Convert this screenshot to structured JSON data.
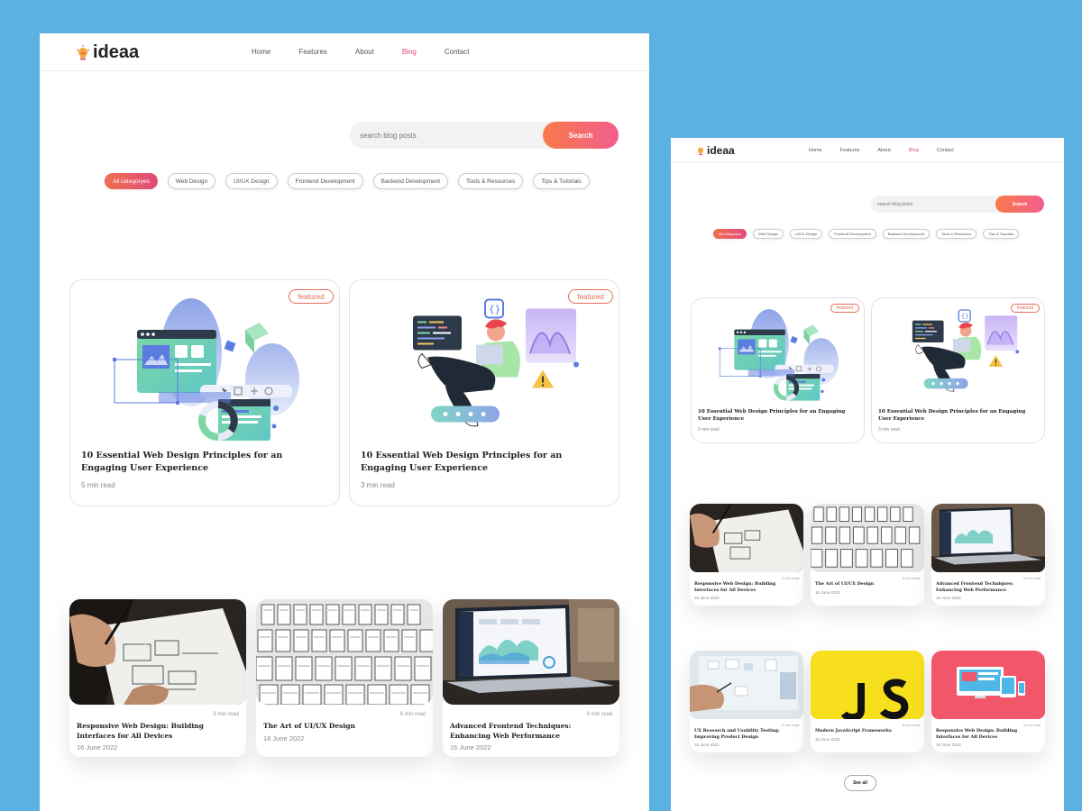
{
  "brand": {
    "name": "ideaa"
  },
  "nav": [
    "Home",
    "Features",
    "About",
    "Blog",
    "Contact"
  ],
  "nav_active": "Blog",
  "search": {
    "placeholder": "search blog posts",
    "button": "Search"
  },
  "categories": [
    "All categoryes",
    "Web Design",
    "UI/UX Design",
    "Frontend Development",
    "Backend Development",
    "Tools & Resources",
    "Tips & Tutorials"
  ],
  "featured": [
    {
      "badge": "featured",
      "title": "10 Essential Web Design Principles for an Engaging User Experience",
      "read": "5 min read"
    },
    {
      "badge": "featured",
      "title": "10 Essential Web Design Principles for an Engaging User Experience",
      "read": "3 min read"
    }
  ],
  "posts": [
    {
      "read": "6 min read",
      "title": "Responsive Web Design: Building Interfaces for All Devices",
      "date": "16 June 2022"
    },
    {
      "read": "6 min read",
      "title": "The Art of UI/UX Design",
      "date": "16 June 2022"
    },
    {
      "read": "6 min read",
      "title": "Advanced Frontend Techniques: Enhancing Web Performance",
      "date": "16 June 2022"
    },
    {
      "read": "6 min read",
      "title": "UX Research and Usability Testing: Improving Product Design",
      "date": "16 June 2022"
    },
    {
      "read": "6 min read",
      "title": "Modern JavaScript Frameworks",
      "date": "16 June 2022"
    },
    {
      "read": "6 min read",
      "title": "Responsive Web Design: Building Interfaces for All Devices",
      "date": "16 June 2022"
    }
  ],
  "see_all": "See all",
  "colors": {
    "background": "#5bb1e2",
    "accent": "#e0487c",
    "button_gradient_start": "#f9794a",
    "button_gradient_end": "#f25e8e"
  }
}
